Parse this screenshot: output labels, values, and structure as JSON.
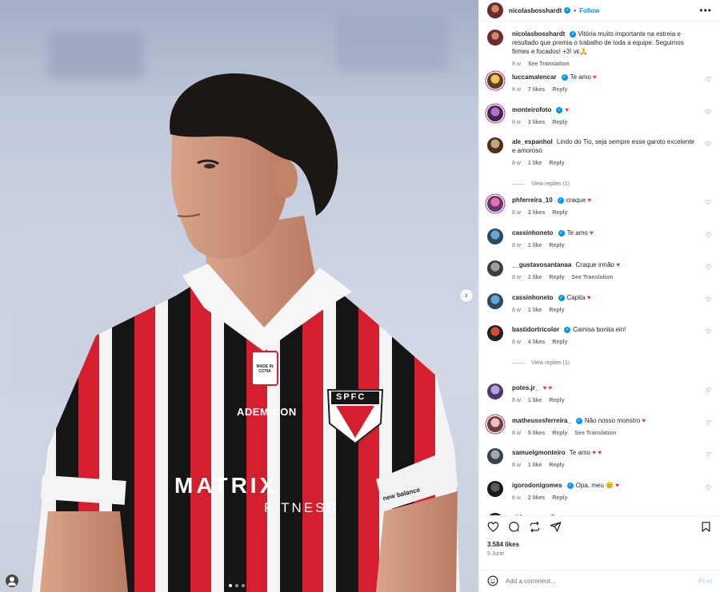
{
  "post": {
    "author": "nicolasbosshardt",
    "follow_label": "Follow",
    "more_label": "•••",
    "dot": "•",
    "caption_text": "Vitória muito importante na estreia e resultado que premia o trabalho de toda a equipe. Seguimos firmes e focados! +3! ᴠᴇ🙏",
    "caption_time": "8 w",
    "see_translation": "See Translation",
    "likes": "3.584 likes",
    "date": "5 June",
    "add_comment_placeholder": "Add a comment...",
    "post_label": "Post",
    "media_slide_count": 3
  },
  "comments": [
    {
      "user": "luccamalencar",
      "verified": true,
      "text": "Te amo",
      "heart": true,
      "time": "8 w",
      "likes": "7 likes",
      "reply": "Reply"
    },
    {
      "user": "monteirofoto",
      "verified": true,
      "text": "",
      "heart": true,
      "time": "8 w",
      "likes": "3 likes",
      "reply": "Reply"
    },
    {
      "user": "ale_espanhol",
      "verified": false,
      "text": "Lindo do Tio, seja sempre esse garoto excelente e amoroso",
      "heart": false,
      "time": "8 w",
      "likes": "1 like",
      "reply": "Reply",
      "view_replies": "View replies (1)"
    },
    {
      "user": "phferreira_10",
      "verified": true,
      "text": "craque",
      "heart": true,
      "time": "8 w",
      "likes": "2 likes",
      "reply": "Reply"
    },
    {
      "user": "cassinhoneto",
      "verified": true,
      "text": "Te amo",
      "heart": true,
      "time": "8 w",
      "likes": "1 like",
      "reply": "Reply"
    },
    {
      "user": "__gustavosantanaa",
      "verified": false,
      "text": "Craque irmão",
      "heart": true,
      "time": "8 w",
      "likes": "1 like",
      "reply": "Reply",
      "translation": "See Translation"
    },
    {
      "user": "cassinhoneto",
      "verified": true,
      "text": "Capita",
      "heart": true,
      "time": "8 w",
      "likes": "1 like",
      "reply": "Reply"
    },
    {
      "user": "bastidortricolor",
      "verified": true,
      "text": "Camisa bonita ein!",
      "heart": false,
      "time": "8 w",
      "likes": "4 likes",
      "reply": "Reply",
      "view_replies": "View replies (1)"
    },
    {
      "user": "potes.jr_",
      "verified": false,
      "text": "",
      "heart": true,
      "double_heart": true,
      "time": "8 w",
      "likes": "1 like",
      "reply": "Reply"
    },
    {
      "user": "matheusssferreira_",
      "verified": true,
      "text": "Não nosso monstro",
      "heart": true,
      "time": "8 w",
      "likes": "5 likes",
      "reply": "Reply",
      "translation": "See Translation"
    },
    {
      "user": "samuelgmonteiro",
      "verified": false,
      "text": "Te amo",
      "heart": true,
      "double_heart": true,
      "time": "8 w",
      "likes": "1 like",
      "reply": "Reply"
    },
    {
      "user": "igorodonigomes",
      "verified": true,
      "text": "Opa, meu",
      "heart": true,
      "emoji": "😊",
      "time": "8 w",
      "likes": "2 likes",
      "reply": "Reply"
    },
    {
      "user": "phbezerra_",
      "verified": false,
      "text": "Craque",
      "heart": true,
      "time": "",
      "likes": "",
      "reply": ""
    }
  ],
  "photo": {
    "jersey_sponsor_1": "ADEMICON",
    "jersey_sponsor_2": "MATRIX",
    "jersey_sponsor_3": "FITNESS",
    "badge": "SPFC",
    "badge_text": "MADE IN COTIA",
    "armband": "new balance"
  },
  "colors": {
    "accent": "#0095f6",
    "heart": "#e8334a",
    "jersey_red": "#d4202e",
    "jersey_black": "#151515"
  }
}
